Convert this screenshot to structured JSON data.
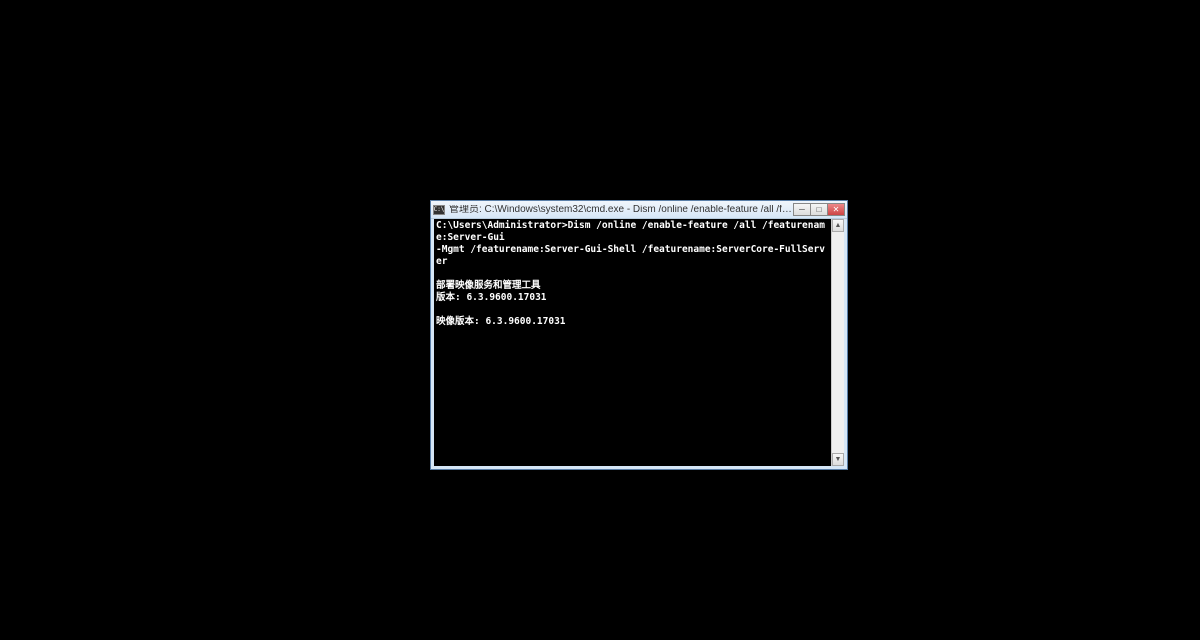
{
  "window": {
    "titlebar": {
      "icon_label": "C:\\",
      "title": "管理员: C:\\Windows\\system32\\cmd.exe - Dism  /online /enable-feature /all /fe..."
    },
    "controls": {
      "minimize_symbol": "─",
      "maximize_symbol": "□",
      "close_symbol": "✕"
    },
    "console": {
      "prompt": "C:\\Users\\Administrator>",
      "command_line1": "Dism /online /enable-feature /all /featurename:Server-Gui",
      "command_line2": "-Mgmt /featurename:Server-Gui-Shell /featurename:ServerCore-FullServer",
      "blank": "",
      "output_line1": "部署映像服务和管理工具",
      "output_line2": "版本: 6.3.9600.17031",
      "output_line3": "映像版本: 6.3.9600.17031"
    },
    "scrollbar": {
      "up": "▲",
      "down": "▼"
    }
  }
}
